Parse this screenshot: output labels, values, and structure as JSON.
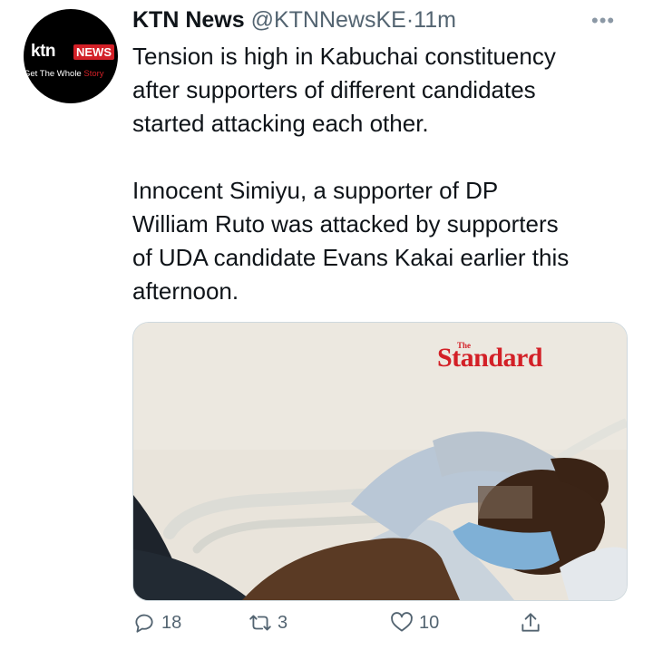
{
  "tweet": {
    "author_name": "KTN News",
    "handle": "@KTNNewsKE",
    "separator": "·",
    "time": "11m",
    "more_icon": "more-icon",
    "text": "Tension is high in Kabuchai  constituency\nafter supporters of different candidates\nstarted attacking each other.\n\nInnocent Simiyu, a supporter of DP\nWilliam Ruto was attacked by supporters\nof UDA candidate Evans Kakai earlier this\nafternoon."
  },
  "avatar": {
    "logo_ktn": "ktn",
    "logo_news": "NEWS",
    "tagline_start": "Get The Whole ",
    "tagline_end": "Story",
    "brand_red": "#d32027"
  },
  "media": {
    "watermark_small": "The",
    "watermark_big": "Standard"
  },
  "actions": {
    "reply_count": "18",
    "retweet_count": "3",
    "like_count": "10",
    "icons": [
      "reply-icon",
      "retweet-icon",
      "like-icon",
      "share-icon"
    ],
    "icon_color": "#536471"
  }
}
